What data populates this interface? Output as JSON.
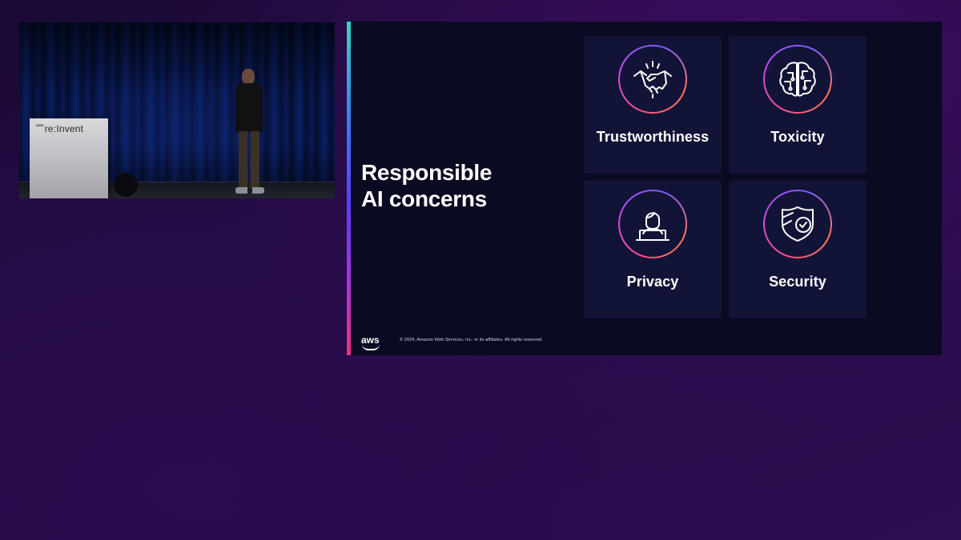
{
  "camera": {
    "podium_logo_small": "AWS",
    "podium_logo": "re:Invent"
  },
  "slide": {
    "title_line1": "Responsible",
    "title_line2": "AI concerns",
    "cards": [
      {
        "label": "Trustworthiness",
        "icon": "handshake-icon"
      },
      {
        "label": "Toxicity",
        "icon": "brain-circuit-icon"
      },
      {
        "label": "Privacy",
        "icon": "person-laptop-icon"
      },
      {
        "label": "Security",
        "icon": "shield-check-icon"
      }
    ],
    "footer": {
      "logo": "aws",
      "copyright": "© 2024, Amazon Web Services, Inc. or its affiliates. All rights reserved."
    },
    "colors": {
      "slide_background": "#0a0a22",
      "card_background": "#121437",
      "ring_gradient": [
        "#ff4f8b",
        "#c04cf0",
        "#7a5cff",
        "#ff7a59"
      ],
      "accent_bar": [
        "#2fd8c4",
        "#3c7af0",
        "#5b3df5",
        "#a534d8",
        "#e8357e"
      ]
    }
  }
}
